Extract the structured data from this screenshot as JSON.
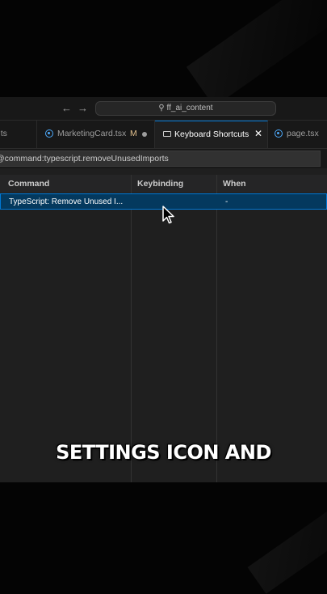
{
  "titlebar": {
    "back_icon": "arrow-left-icon",
    "forward_icon": "arrow-right-icon",
    "search_icon": "search-icon",
    "command_center_label": "ff_ai_content"
  },
  "tabs": [
    {
      "label": "e.ts",
      "icon": "typescript-icon"
    },
    {
      "label": "MarketingCard.tsx",
      "badge": "M",
      "icon": "react-icon"
    },
    {
      "label": "Keyboard Shortcuts",
      "icon": "keyboard-icon",
      "active": true
    },
    {
      "label": "page.tsx",
      "icon": "react-icon"
    }
  ],
  "search": {
    "value": "@command:typescript.removeUnusedImports"
  },
  "table": {
    "headers": [
      "Command",
      "Keybinding",
      "When"
    ],
    "rows": [
      {
        "command": "TypeScript: Remove Unused I...",
        "keybinding": "",
        "when": "-"
      }
    ]
  },
  "caption": "SETTINGS ICON AND",
  "colors": {
    "accent": "#0078d4",
    "selection": "#04395e",
    "editor_bg": "#1f1f1f"
  }
}
